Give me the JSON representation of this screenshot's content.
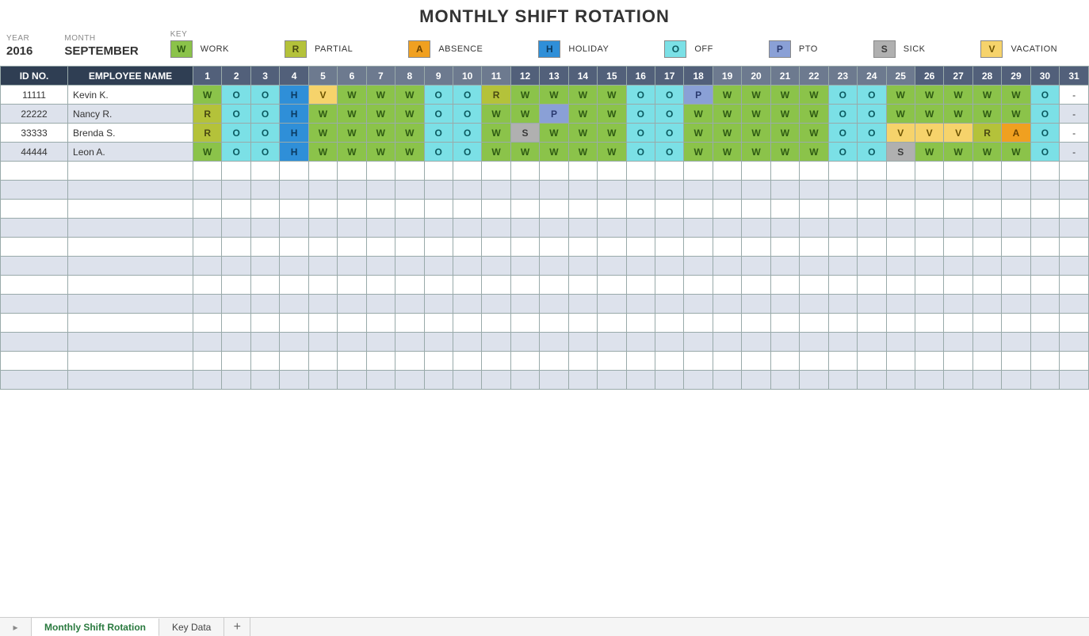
{
  "title": "MONTHLY SHIFT ROTATION",
  "meta": {
    "year_label": "YEAR",
    "year_value": "2016",
    "month_label": "MONTH",
    "month_value": "SEPTEMBER",
    "key_label": "KEY"
  },
  "key": [
    {
      "code": "W",
      "label": "WORK",
      "cls": "c-W"
    },
    {
      "code": "R",
      "label": "PARTIAL",
      "cls": "c-R"
    },
    {
      "code": "A",
      "label": "ABSENCE",
      "cls": "c-A"
    },
    {
      "code": "H",
      "label": "HOLIDAY",
      "cls": "c-H"
    },
    {
      "code": "O",
      "label": "OFF",
      "cls": "c-O"
    },
    {
      "code": "P",
      "label": "PTO",
      "cls": "c-P"
    },
    {
      "code": "S",
      "label": "SICK",
      "cls": "c-S"
    },
    {
      "code": "V",
      "label": "VACATION",
      "cls": "c-V"
    }
  ],
  "headers": {
    "id": "ID NO.",
    "name": "EMPLOYEE NAME"
  },
  "days": [
    "1",
    "2",
    "3",
    "4",
    "5",
    "6",
    "7",
    "8",
    "9",
    "10",
    "11",
    "12",
    "13",
    "14",
    "15",
    "16",
    "17",
    "18",
    "19",
    "20",
    "21",
    "22",
    "23",
    "24",
    "25",
    "26",
    "27",
    "28",
    "29",
    "30",
    "31"
  ],
  "header_shade": [
    "alt",
    "alt",
    "alt",
    "alt",
    "dim",
    "dim",
    "dim",
    "dim",
    "dim",
    "dim",
    "dim",
    "alt",
    "alt",
    "alt",
    "alt",
    "alt",
    "alt",
    "alt",
    "dim",
    "dim",
    "dim",
    "dim",
    "dim",
    "dim",
    "dim",
    "alt",
    "alt",
    "alt",
    "alt",
    "alt",
    "alt"
  ],
  "rows": [
    {
      "id": "11111",
      "name": "Kevin K.",
      "cells": [
        "W",
        "O",
        "O",
        "H",
        "V",
        "W",
        "W",
        "W",
        "O",
        "O",
        "R",
        "W",
        "W",
        "W",
        "W",
        "O",
        "O",
        "P",
        "W",
        "W",
        "W",
        "W",
        "O",
        "O",
        "W",
        "W",
        "W",
        "W",
        "W",
        "O",
        "-"
      ]
    },
    {
      "id": "22222",
      "name": "Nancy R.",
      "cells": [
        "R",
        "O",
        "O",
        "H",
        "W",
        "W",
        "W",
        "W",
        "O",
        "O",
        "W",
        "W",
        "P",
        "W",
        "W",
        "O",
        "O",
        "W",
        "W",
        "W",
        "W",
        "W",
        "O",
        "O",
        "W",
        "W",
        "W",
        "W",
        "W",
        "O",
        "-"
      ]
    },
    {
      "id": "33333",
      "name": "Brenda S.",
      "cells": [
        "R",
        "O",
        "O",
        "H",
        "W",
        "W",
        "W",
        "W",
        "O",
        "O",
        "W",
        "S",
        "W",
        "W",
        "W",
        "O",
        "O",
        "W",
        "W",
        "W",
        "W",
        "W",
        "O",
        "O",
        "V",
        "V",
        "V",
        "R",
        "A",
        "O",
        "-"
      ]
    },
    {
      "id": "44444",
      "name": "Leon A.",
      "cells": [
        "W",
        "O",
        "O",
        "H",
        "W",
        "W",
        "W",
        "W",
        "O",
        "O",
        "W",
        "W",
        "W",
        "W",
        "W",
        "O",
        "O",
        "W",
        "W",
        "W",
        "W",
        "W",
        "O",
        "O",
        "S",
        "W",
        "W",
        "W",
        "W",
        "O",
        "-"
      ]
    }
  ],
  "empty_rows": 12,
  "tabs": {
    "active": "Monthly Shift Rotation",
    "other": "Key Data",
    "add": "+"
  }
}
